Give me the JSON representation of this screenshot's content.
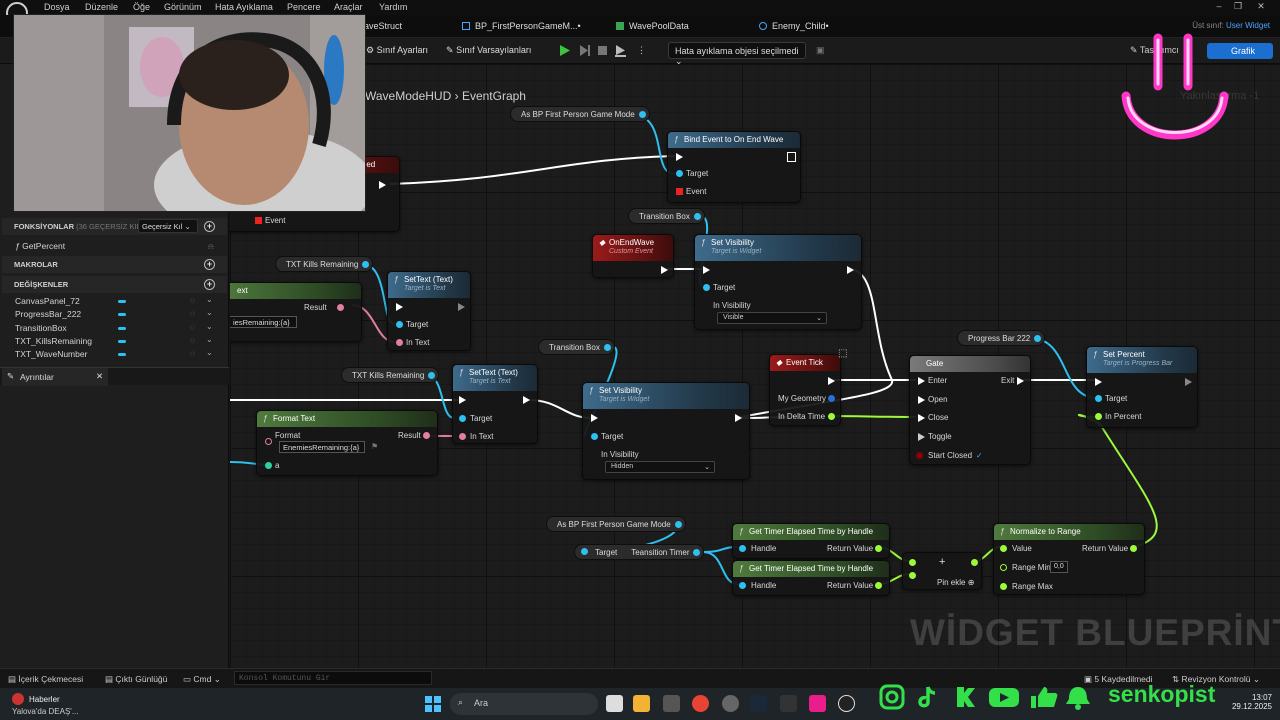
{
  "menu": [
    "Dosya",
    "Düzenle",
    "Öğe",
    "Görünüm",
    "Hata Ayıklama",
    "Pencere",
    "Araçlar",
    "Yardım"
  ],
  "tabs": [
    {
      "label": "aveStruct"
    },
    {
      "label": "BP_FirstPersonGameM...•"
    },
    {
      "label": "WavePoolData"
    },
    {
      "label": "Enemy_Child•"
    }
  ],
  "parent_class": {
    "label": "Üst sınıf:",
    "value": "User Widget"
  },
  "toolbar": {
    "class_settings": "Sınıf Ayarları",
    "class_defaults": "Sınıf Varsayılanları",
    "debug_object": "Hata ayıklama objesi seçilmedi",
    "designer": "Tasarımcı",
    "graph": "Grafik"
  },
  "left_panel": {
    "functions_title": "FONKSİYONLAR",
    "functions_sub": "(36 GEÇERSİZ KILIN",
    "invalid_button": "Geçersiz Kıl",
    "functions": [
      "GetPercent"
    ],
    "macros_title": "MAKROLAR",
    "variables_title": "DEĞİŞKENLER",
    "variables": [
      "CanvasPanel_72",
      "ProgressBar_222",
      "TransitionBox",
      "TXT_KillsRemaining",
      "TXT_WaveNumber"
    ],
    "details_tab": "Ayrıntılar"
  },
  "graph": {
    "breadcrumb_root": "WaveModeHUD",
    "breadcrumb_leaf": "EventGraph",
    "zoom": "Yakınlaştırma -1",
    "watermark": "WİDGET BLUEPRİNT'İ",
    "accent_exec": "#ffffff",
    "accent_object": "#2ec0f0",
    "accent_text": "#e07fa0",
    "accent_float": "#9cfa3b"
  },
  "nodes": {
    "get_game_mode_1": "As BP First Person Game Mode",
    "bind_event": {
      "title": "Bind Event to On End Wave",
      "target": "Target",
      "event": "Event"
    },
    "partial_killed": "illed",
    "event_pin": "Event",
    "get_transition_box_1": "Transition Box",
    "on_end_wave": {
      "title": "OnEndWave",
      "sub": "Custom Event"
    },
    "set_visibility_1": {
      "title": "Set Visibility",
      "sub": "Target is Widget",
      "target": "Target",
      "in_visibility": "In Visibility",
      "value": "Visible"
    },
    "get_kills_remaining_1": "TXT Kills Remaining",
    "set_text_1": {
      "title": "SetText (Text)",
      "sub": "Target is Text",
      "target": "Target",
      "in_text": "In Text"
    },
    "partial_ext": "ext",
    "result_label": "Result",
    "partial_format": "iesRemaining:{a}",
    "get_progress_bar": "Progress Bar 222",
    "set_percent": {
      "title": "Set Percent",
      "sub": "Target is Progress Bar",
      "target": "Target",
      "in_percent": "In Percent"
    },
    "event_tick": {
      "title": "Event Tick",
      "geometry": "My Geometry",
      "delta": "In Delta Time"
    },
    "gate": {
      "title": "Gate",
      "enter": "Enter",
      "exit": "Exit",
      "open": "Open",
      "close": "Close",
      "toggle": "Toggle",
      "start_closed": "Start Closed"
    },
    "get_transition_box_2": "Transition Box",
    "get_kills_remaining_2": "TXT Kills Remaining",
    "set_text_2": {
      "title": "SetText (Text)",
      "sub": "Target is Text",
      "target": "Target",
      "in_text": "In Text"
    },
    "set_visibility_2": {
      "title": "Set Visibility",
      "sub": "Target is Widget",
      "target": "Target",
      "in_visibility": "In Visibility",
      "value": "Hidden"
    },
    "format_text": {
      "title": "Format Text",
      "format": "Format",
      "format_value": "EnemiesRemaining:{a}",
      "result": "Result",
      "a": "a"
    },
    "get_game_mode_2": "As BP First Person Game Mode",
    "transition_timer": {
      "target": "Target",
      "name": "Teansition Timer"
    },
    "get_elapsed_1": {
      "title": "Get Timer Elapsed Time by Handle",
      "handle": "Handle",
      "ret": "Return Value"
    },
    "get_elapsed_2": {
      "title": "Get Timer Elapsed Time by Handle",
      "handle": "Handle",
      "ret": "Return Value"
    },
    "divide": {
      "add_pin": "Pin ekle"
    },
    "normalize": {
      "title": "Normalize to Range",
      "value": "Value",
      "ret": "Return Value",
      "range_min": "Range Min",
      "range_min_value": "0,0",
      "range_max": "Range Max"
    }
  },
  "statusbar": {
    "content_drawer": "İçerik Çekmecesi",
    "output_log": "Çıktı Günlüğü",
    "cmd": "Cmd",
    "cmd_placeholder": "Konsol Komutunu Gir",
    "saved": "5 Kaydedilmedi",
    "revision": "Revizyon Kontrolü"
  },
  "taskbar": {
    "news_title": "Haberler",
    "news_sub": "Yalova'da DEAŞ'...",
    "search": "Ara",
    "time": "13:07",
    "date": "29.12.2025"
  },
  "overlay": {
    "brand": "senkopist"
  }
}
